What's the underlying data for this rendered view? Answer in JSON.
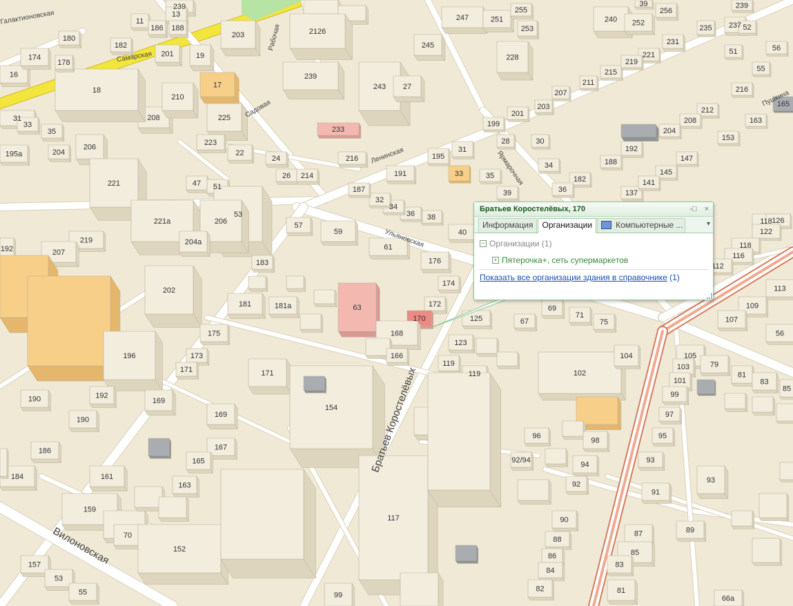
{
  "colors": {
    "background": "#efe9d6",
    "road": "#ffffff",
    "road_edge": "#d9d1bb",
    "major_road": "#f2e63c",
    "major_road_edge": "#d4b52a",
    "tram_road": "#f1a98e",
    "tram_edge": "#d87a5c",
    "building": "#f3edde",
    "building_side": "#ddd5be",
    "building_edge": "#b9b09a",
    "orange_building": "#f7cf88",
    "pink_building": "#f3b9b1",
    "selected_building": "#ee8a84",
    "gray_block": "#a9adb2",
    "park": "#b7e3a4",
    "popup_border": "#8fc79b",
    "link": "#1a4fb4"
  },
  "streets": [
    {
      "name": "Садовая"
    },
    {
      "name": "Ленинская"
    },
    {
      "name": "Ульяновская"
    },
    {
      "name": "Братьев Коростелёвых"
    },
    {
      "name": "Вилоновская"
    },
    {
      "name": "Ярмарочная"
    },
    {
      "name": "Пушкина"
    },
    {
      "name": "Самарская"
    },
    {
      "name": "Галактионовская"
    },
    {
      "name": "Рабочая"
    }
  ],
  "house_numbers": [
    "239",
    "256",
    "39",
    "237",
    "52",
    "56",
    "247",
    "251",
    "255",
    "253",
    "240",
    "252",
    "235",
    "245",
    "231",
    "55",
    "51",
    "221",
    "215",
    "219",
    "228",
    "216",
    "211",
    "207",
    "203",
    "165",
    "212",
    "208",
    "163",
    "201",
    "204",
    "199",
    "192",
    "28",
    "30",
    "153",
    "147",
    "188",
    "31",
    "195",
    "182",
    "145",
    "33",
    "34",
    "35",
    "137",
    "141",
    "36",
    "39",
    "38",
    "36",
    "34",
    "32",
    "187",
    "191",
    "2126",
    "239",
    "243",
    "27",
    "233",
    "216",
    "225",
    "208",
    "18",
    "16",
    "174",
    "178",
    "180",
    "182",
    "11",
    "186",
    "188",
    "13",
    "203",
    "201",
    "19",
    "17",
    "210",
    "31",
    "33",
    "35",
    "195a",
    "204",
    "206",
    "223",
    "22",
    "24",
    "26",
    "214",
    "221",
    "221a",
    "47",
    "51",
    "53",
    "206",
    "219",
    "204a",
    "207",
    "192",
    "202",
    "57",
    "59",
    "61",
    "176",
    "174",
    "172",
    "183",
    "181",
    "181a",
    "63",
    "170",
    "168",
    "166",
    "125",
    "123",
    "119",
    "119",
    "67",
    "69",
    "71",
    "75",
    "102",
    "104",
    "175",
    "173",
    "171",
    "196",
    "190",
    "192",
    "190",
    "186",
    "184",
    "169",
    "171",
    "154",
    "169",
    "167",
    "165",
    "163",
    "161",
    "159",
    "70",
    "152",
    "157",
    "53",
    "55",
    "117",
    "99",
    "96",
    "92/94",
    "98",
    "94",
    "92",
    "90",
    "88",
    "86",
    "84",
    "82",
    "97",
    "95",
    "93",
    "93",
    "91",
    "89",
    "87",
    "85",
    "83",
    "81",
    "118",
    "126",
    "122",
    "118",
    "116",
    "112",
    "113",
    "109",
    "107",
    "56",
    "105",
    "103",
    "101",
    "99",
    "79",
    "81",
    "83",
    "85",
    "66a",
    "40"
  ],
  "popup": {
    "title": "Братьев Коростелёвых, 170",
    "pin_icon_label": "-□",
    "close_icon_label": "×",
    "tabs": [
      {
        "label": "Информация",
        "active": false
      },
      {
        "label": "Организации",
        "active": true
      },
      {
        "label": "Компьютерные ...",
        "active": false,
        "icon": "computer-icon"
      }
    ],
    "more_label": "▾",
    "group_toggle": "−",
    "group_label": "Организации (1)",
    "org_toggle": "+",
    "org_label": "Пятерочка+, сеть супермаркетов",
    "show_all_link": "Показать все организации здания в справочнике",
    "show_all_count": "(1)"
  }
}
